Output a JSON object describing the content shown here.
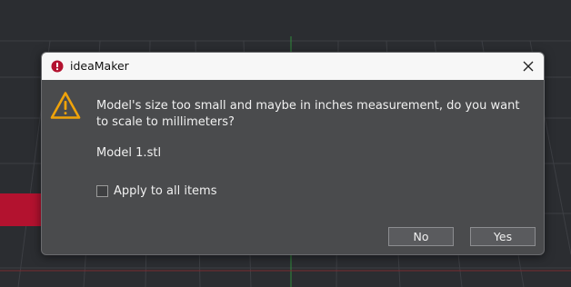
{
  "dialog": {
    "title": "ideaMaker",
    "message": "Model's size too small and maybe in inches measurement, do you want to scale to millimeters?",
    "model_name": "Model 1.stl",
    "checkbox_label": "Apply to all items",
    "checkbox_checked": false,
    "no_label": "No",
    "yes_label": "Yes"
  },
  "icons": {
    "app": "ideamaker-app-icon",
    "warning": "warning-icon",
    "close": "close-icon"
  },
  "colors": {
    "background": "#2b2d31",
    "dialog_body": "#4a4b4d",
    "titlebar": "#f7f7f7",
    "warning": "#f0a30a",
    "app_icon": "#b3122f",
    "model_object": "#b3122f"
  }
}
